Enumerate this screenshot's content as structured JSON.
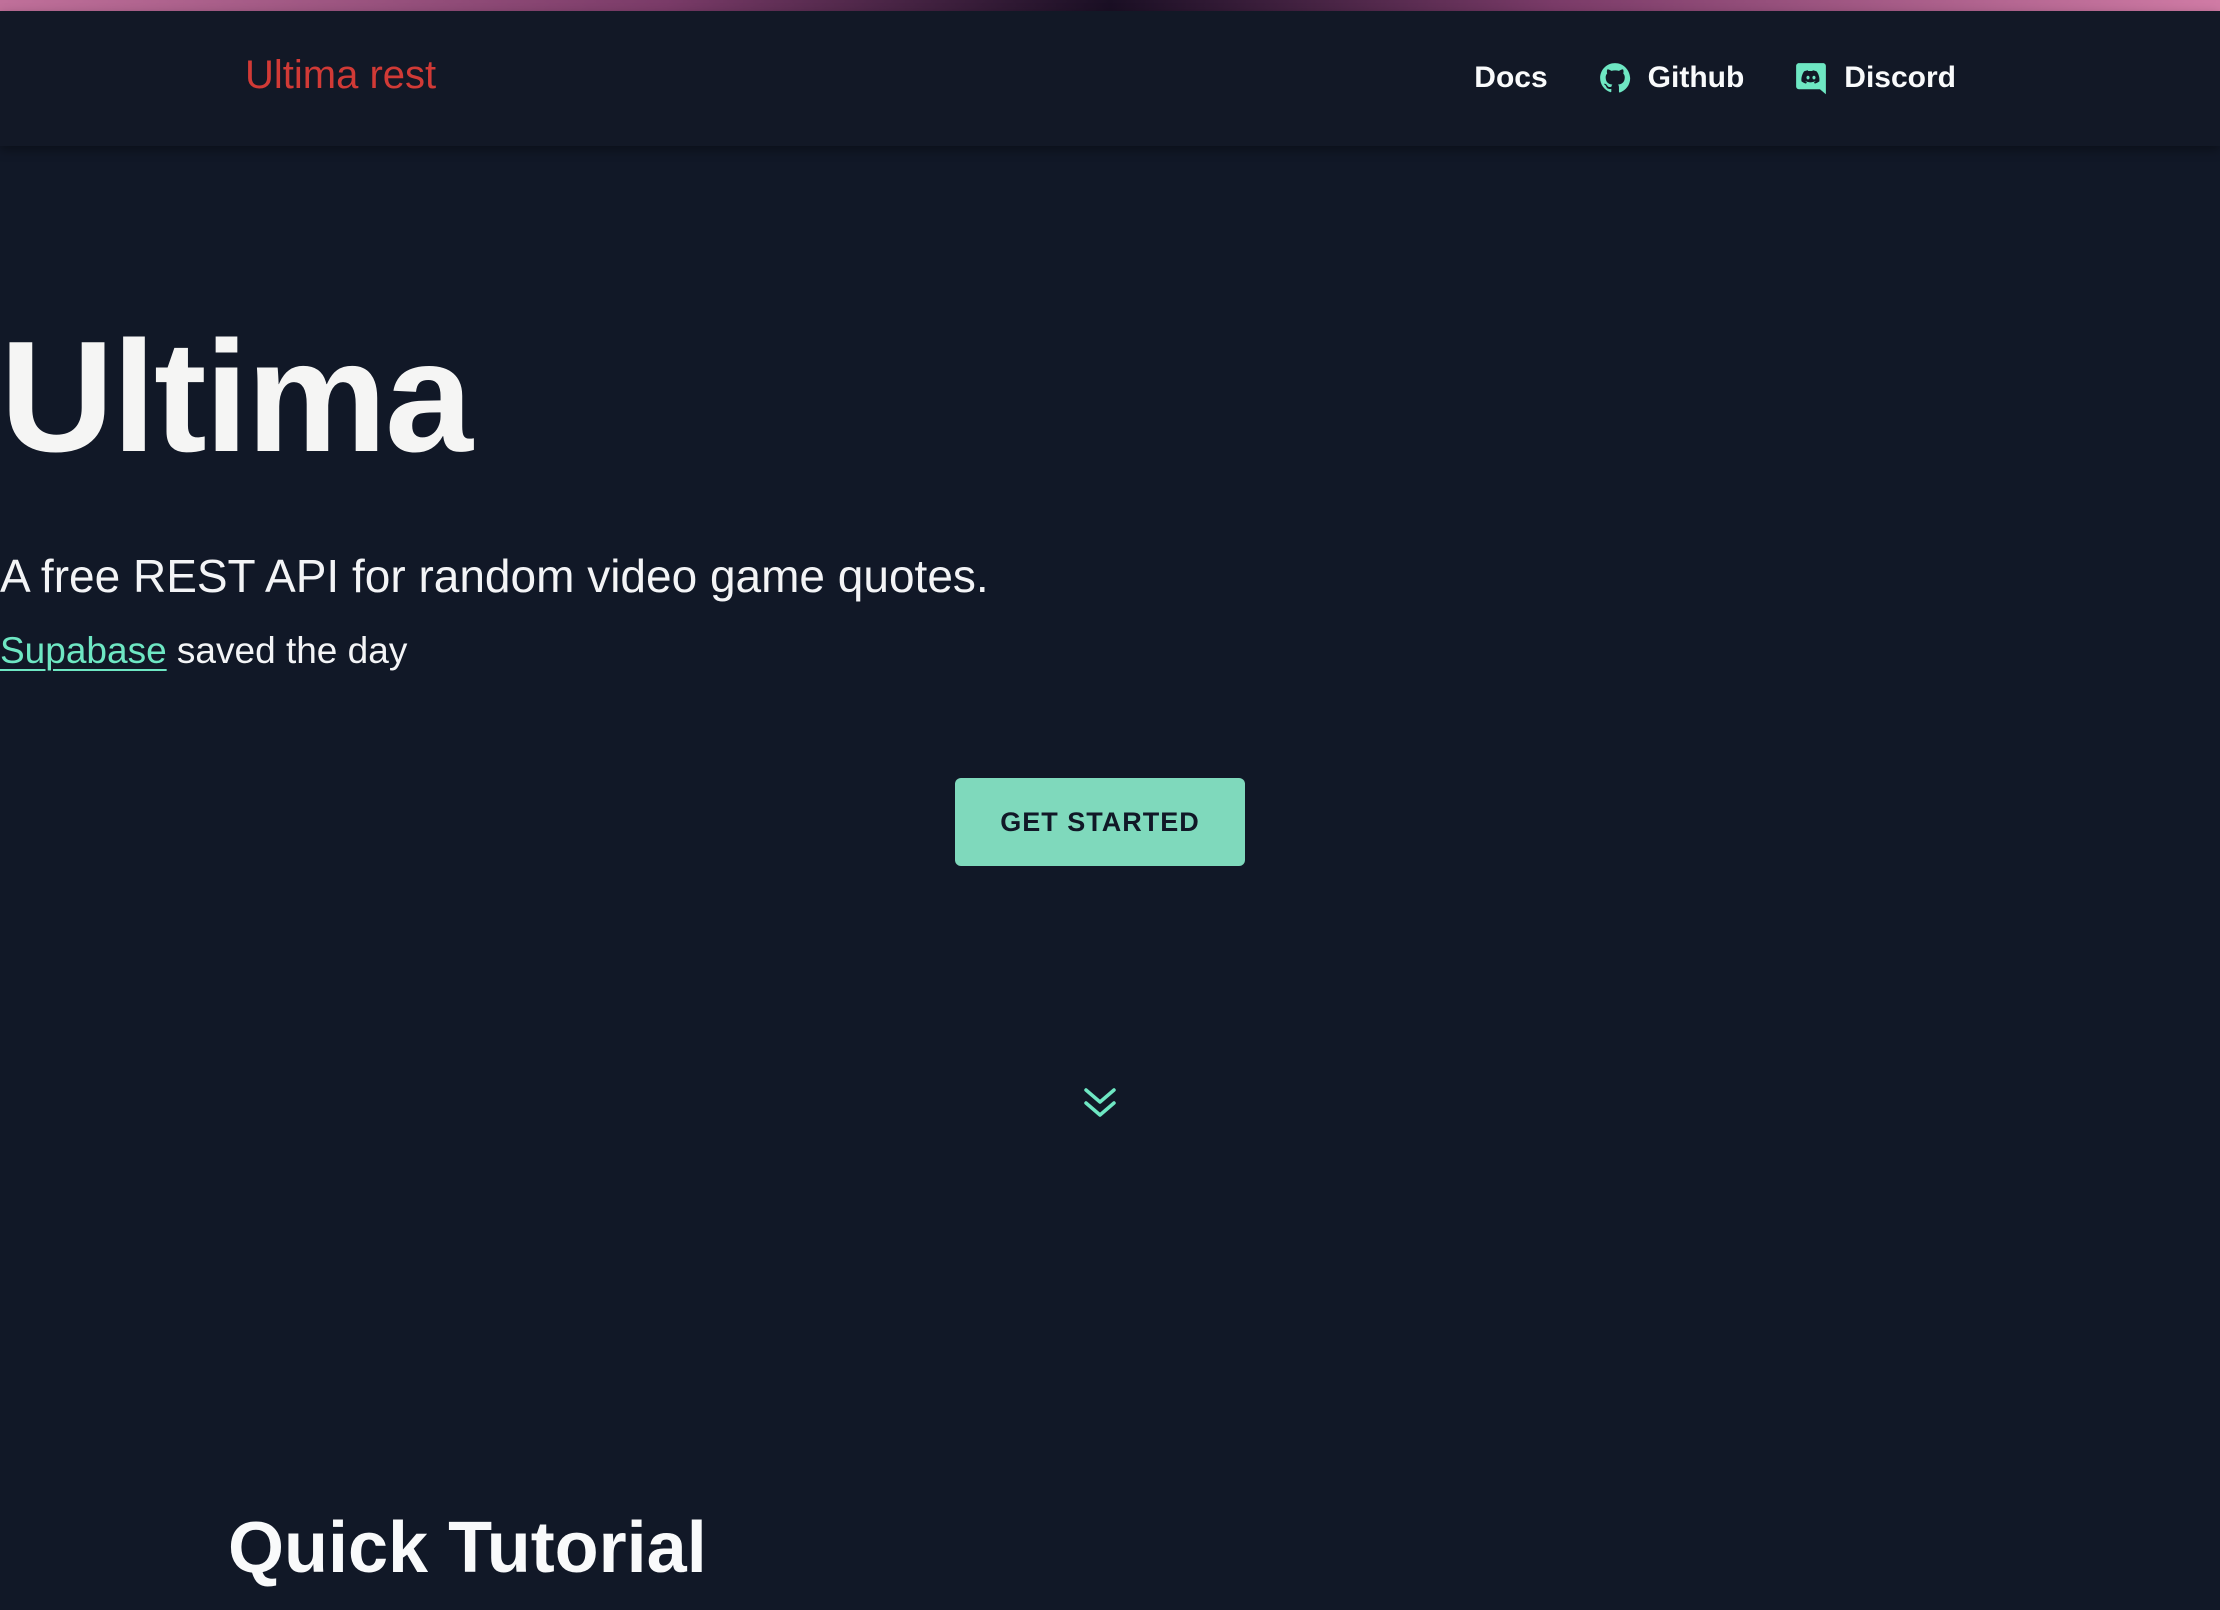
{
  "header": {
    "brand": "Ultima rest",
    "nav": {
      "docs": "Docs",
      "github": "Github",
      "discord": "Discord"
    }
  },
  "hero": {
    "title": "Ultima",
    "subtitle": "A free REST API for random video game quotes.",
    "link_text": "Supabase",
    "link_suffix": " saved the day",
    "cta_label": "GET STARTED"
  },
  "tutorial": {
    "title": "Quick Tutorial"
  },
  "icons": {
    "github": "github-icon",
    "discord": "discord-icon",
    "scroll": "chevron-double-down-icon"
  },
  "colors": {
    "background": "#111827",
    "brand": "#d13a36",
    "accent": "#7fd9bc"
  }
}
